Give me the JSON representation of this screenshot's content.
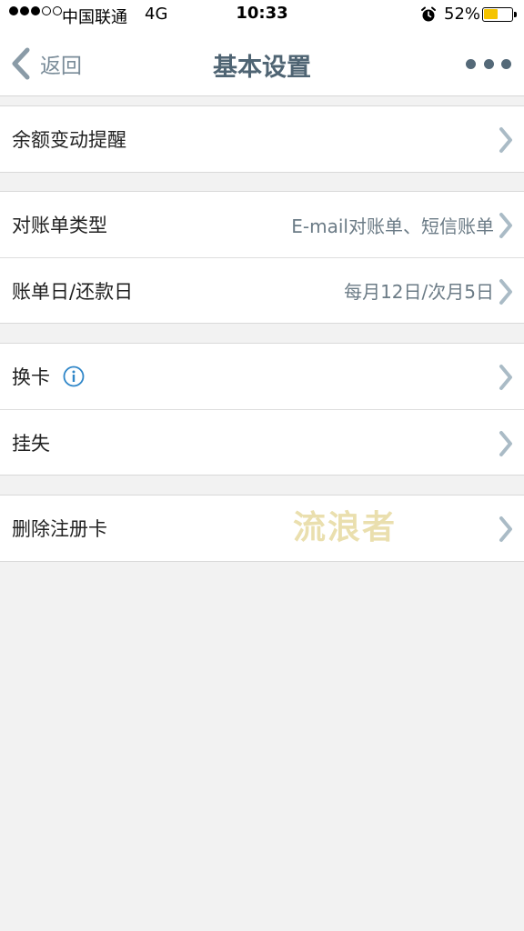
{
  "status_bar": {
    "carrier": "中国联通",
    "network": "4G",
    "time": "10:33",
    "battery_percent": "52%",
    "battery_level": 0.52,
    "battery_color": "#f5c400",
    "alarm_icon": "alarm-clock-icon"
  },
  "nav": {
    "back_label": "返回",
    "title": "基本设置",
    "more_icon": "ellipsis-icon"
  },
  "groups": [
    {
      "rows": [
        {
          "label": "余额变动提醒",
          "value": ""
        }
      ]
    },
    {
      "rows": [
        {
          "label": "对账单类型",
          "value": "E-mail对账单、短信账单"
        },
        {
          "label": "账单日/还款日",
          "value": "每月12日/次月5日"
        }
      ]
    },
    {
      "rows": [
        {
          "label": "换卡",
          "value": "",
          "icon": "info-icon"
        },
        {
          "label": "挂失",
          "value": ""
        }
      ]
    },
    {
      "rows": [
        {
          "label": "删除注册卡",
          "value": ""
        }
      ]
    }
  ],
  "watermark": "流浪者",
  "colors": {
    "chevron": "#aabbc6",
    "title": "#4f6473",
    "info": "#2f86c8"
  }
}
